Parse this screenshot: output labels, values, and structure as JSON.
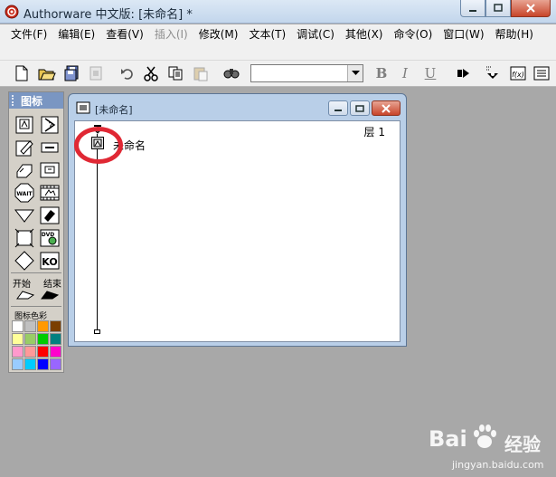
{
  "window": {
    "title": "Authorware 中文版: [未命名] *"
  },
  "menu": {
    "items": [
      {
        "label": "文件(F)",
        "disabled": false
      },
      {
        "label": "编辑(E)",
        "disabled": false
      },
      {
        "label": "查看(V)",
        "disabled": false
      },
      {
        "label": "插入(I)",
        "disabled": true
      },
      {
        "label": "修改(M)",
        "disabled": false
      },
      {
        "label": "文本(T)",
        "disabled": false
      },
      {
        "label": "调试(C)",
        "disabled": false
      },
      {
        "label": "其他(X)",
        "disabled": false
      },
      {
        "label": "命令(O)",
        "disabled": false
      },
      {
        "label": "窗口(W)",
        "disabled": false
      },
      {
        "label": "帮助(H)",
        "disabled": false
      }
    ]
  },
  "toolbar": {
    "icons": [
      "new-file-icon",
      "open-file-icon",
      "save-all-icon",
      "import-icon",
      "undo-icon",
      "cut-icon",
      "copy-icon",
      "paste-icon",
      "find-icon",
      "style-dropdown",
      "bold-icon",
      "italic-icon",
      "underline-icon",
      "run-icon",
      "control-panel-icon",
      "functions-icon",
      "variables-icon"
    ],
    "style_value": "",
    "bold_label": "B",
    "italic_label": "I",
    "underline_label": "U",
    "functions_label": "f(x)"
  },
  "palette": {
    "title": "图标",
    "icons": [
      "display-icon",
      "motion-icon",
      "erase-icon",
      "wait-icon",
      "navigate-icon",
      "framework-icon",
      "decision-icon",
      "interaction-icon",
      "calculation-icon",
      "map-icon",
      "movie-icon",
      "sound-icon",
      "video-icon",
      "knowledge-object-icon"
    ],
    "wait_label": "WAIT",
    "dvd_label": "DVD",
    "ko_label": "KO",
    "start_label": "开始",
    "end_label": "结束",
    "colors_label": "图标色彩",
    "colors": [
      "#ffffff",
      "#c0c0c0",
      "#ff9900",
      "#7a3e00",
      "#ffff99",
      "#99cc66",
      "#00cc00",
      "#008080",
      "#ff99cc",
      "#ff9999",
      "#ff0000",
      "#ff00cc",
      "#99ccff",
      "#00ccff",
      "#0000ff",
      "#9966ff"
    ]
  },
  "child_window": {
    "title": "[未命名]",
    "layer_label": "层 1",
    "flow_icon_label": "未命名"
  },
  "watermark": {
    "brand": "Bai",
    "brand_suffix": "经验",
    "url": "jingyan.baidu.com"
  },
  "colors": {
    "highlight_circle": "#e02834",
    "palette_header": "#7a96c2"
  }
}
